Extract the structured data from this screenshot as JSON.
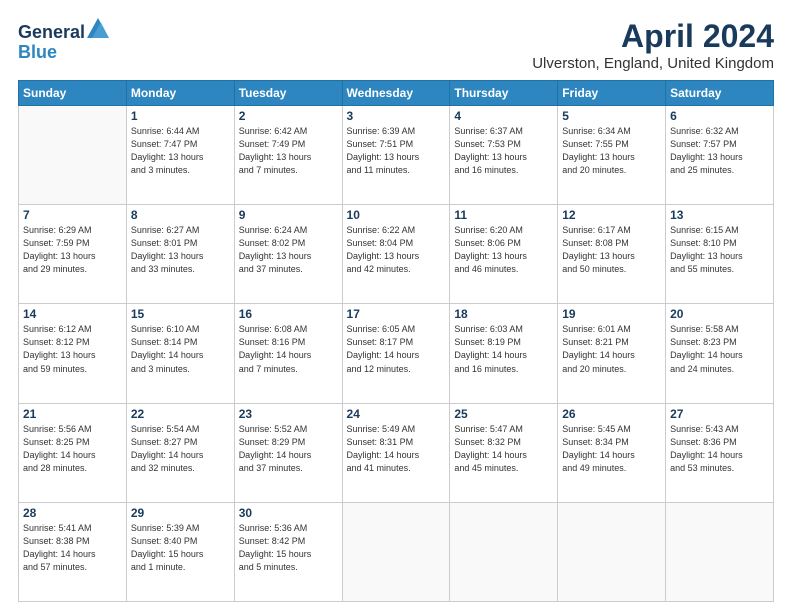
{
  "header": {
    "logo_line1": "General",
    "logo_line2": "Blue",
    "month_title": "April 2024",
    "location": "Ulverston, England, United Kingdom"
  },
  "days_of_week": [
    "Sunday",
    "Monday",
    "Tuesday",
    "Wednesday",
    "Thursday",
    "Friday",
    "Saturday"
  ],
  "weeks": [
    [
      {
        "day": "",
        "info": ""
      },
      {
        "day": "1",
        "info": "Sunrise: 6:44 AM\nSunset: 7:47 PM\nDaylight: 13 hours\nand 3 minutes."
      },
      {
        "day": "2",
        "info": "Sunrise: 6:42 AM\nSunset: 7:49 PM\nDaylight: 13 hours\nand 7 minutes."
      },
      {
        "day": "3",
        "info": "Sunrise: 6:39 AM\nSunset: 7:51 PM\nDaylight: 13 hours\nand 11 minutes."
      },
      {
        "day": "4",
        "info": "Sunrise: 6:37 AM\nSunset: 7:53 PM\nDaylight: 13 hours\nand 16 minutes."
      },
      {
        "day": "5",
        "info": "Sunrise: 6:34 AM\nSunset: 7:55 PM\nDaylight: 13 hours\nand 20 minutes."
      },
      {
        "day": "6",
        "info": "Sunrise: 6:32 AM\nSunset: 7:57 PM\nDaylight: 13 hours\nand 25 minutes."
      }
    ],
    [
      {
        "day": "7",
        "info": "Sunrise: 6:29 AM\nSunset: 7:59 PM\nDaylight: 13 hours\nand 29 minutes."
      },
      {
        "day": "8",
        "info": "Sunrise: 6:27 AM\nSunset: 8:01 PM\nDaylight: 13 hours\nand 33 minutes."
      },
      {
        "day": "9",
        "info": "Sunrise: 6:24 AM\nSunset: 8:02 PM\nDaylight: 13 hours\nand 37 minutes."
      },
      {
        "day": "10",
        "info": "Sunrise: 6:22 AM\nSunset: 8:04 PM\nDaylight: 13 hours\nand 42 minutes."
      },
      {
        "day": "11",
        "info": "Sunrise: 6:20 AM\nSunset: 8:06 PM\nDaylight: 13 hours\nand 46 minutes."
      },
      {
        "day": "12",
        "info": "Sunrise: 6:17 AM\nSunset: 8:08 PM\nDaylight: 13 hours\nand 50 minutes."
      },
      {
        "day": "13",
        "info": "Sunrise: 6:15 AM\nSunset: 8:10 PM\nDaylight: 13 hours\nand 55 minutes."
      }
    ],
    [
      {
        "day": "14",
        "info": "Sunrise: 6:12 AM\nSunset: 8:12 PM\nDaylight: 13 hours\nand 59 minutes."
      },
      {
        "day": "15",
        "info": "Sunrise: 6:10 AM\nSunset: 8:14 PM\nDaylight: 14 hours\nand 3 minutes."
      },
      {
        "day": "16",
        "info": "Sunrise: 6:08 AM\nSunset: 8:16 PM\nDaylight: 14 hours\nand 7 minutes."
      },
      {
        "day": "17",
        "info": "Sunrise: 6:05 AM\nSunset: 8:17 PM\nDaylight: 14 hours\nand 12 minutes."
      },
      {
        "day": "18",
        "info": "Sunrise: 6:03 AM\nSunset: 8:19 PM\nDaylight: 14 hours\nand 16 minutes."
      },
      {
        "day": "19",
        "info": "Sunrise: 6:01 AM\nSunset: 8:21 PM\nDaylight: 14 hours\nand 20 minutes."
      },
      {
        "day": "20",
        "info": "Sunrise: 5:58 AM\nSunset: 8:23 PM\nDaylight: 14 hours\nand 24 minutes."
      }
    ],
    [
      {
        "day": "21",
        "info": "Sunrise: 5:56 AM\nSunset: 8:25 PM\nDaylight: 14 hours\nand 28 minutes."
      },
      {
        "day": "22",
        "info": "Sunrise: 5:54 AM\nSunset: 8:27 PM\nDaylight: 14 hours\nand 32 minutes."
      },
      {
        "day": "23",
        "info": "Sunrise: 5:52 AM\nSunset: 8:29 PM\nDaylight: 14 hours\nand 37 minutes."
      },
      {
        "day": "24",
        "info": "Sunrise: 5:49 AM\nSunset: 8:31 PM\nDaylight: 14 hours\nand 41 minutes."
      },
      {
        "day": "25",
        "info": "Sunrise: 5:47 AM\nSunset: 8:32 PM\nDaylight: 14 hours\nand 45 minutes."
      },
      {
        "day": "26",
        "info": "Sunrise: 5:45 AM\nSunset: 8:34 PM\nDaylight: 14 hours\nand 49 minutes."
      },
      {
        "day": "27",
        "info": "Sunrise: 5:43 AM\nSunset: 8:36 PM\nDaylight: 14 hours\nand 53 minutes."
      }
    ],
    [
      {
        "day": "28",
        "info": "Sunrise: 5:41 AM\nSunset: 8:38 PM\nDaylight: 14 hours\nand 57 minutes."
      },
      {
        "day": "29",
        "info": "Sunrise: 5:39 AM\nSunset: 8:40 PM\nDaylight: 15 hours\nand 1 minute."
      },
      {
        "day": "30",
        "info": "Sunrise: 5:36 AM\nSunset: 8:42 PM\nDaylight: 15 hours\nand 5 minutes."
      },
      {
        "day": "",
        "info": ""
      },
      {
        "day": "",
        "info": ""
      },
      {
        "day": "",
        "info": ""
      },
      {
        "day": "",
        "info": ""
      }
    ]
  ]
}
